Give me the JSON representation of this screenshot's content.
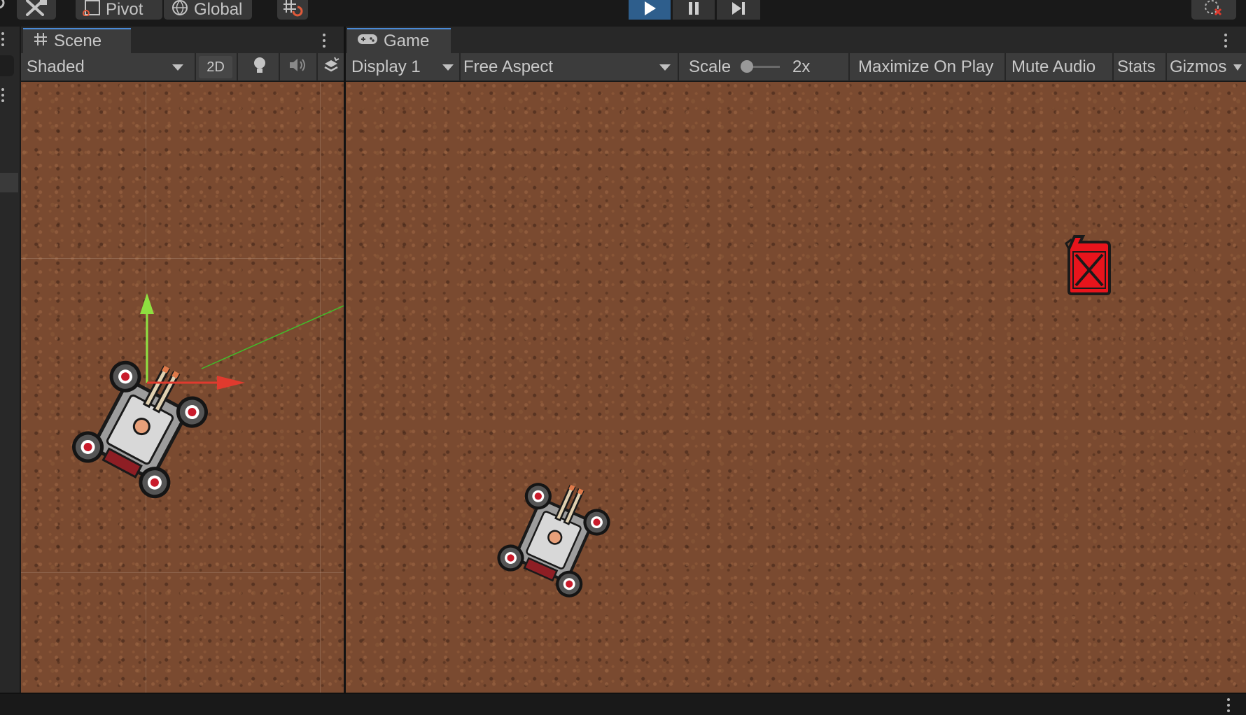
{
  "toolbar": {
    "pivot_label": "Pivot",
    "global_label": "Global",
    "play_state": "playing"
  },
  "scene_panel": {
    "tab_label": "Scene",
    "shading_mode": "Shaded",
    "mode_2d_label": "2D"
  },
  "game_panel": {
    "tab_label": "Game",
    "display_label": "Display 1",
    "aspect_label": "Free Aspect",
    "scale_label": "Scale",
    "scale_value": "2x",
    "maximize_label": "Maximize On Play",
    "mute_label": "Mute Audio",
    "stats_label": "Stats",
    "gizmos_label": "Gizmos"
  },
  "colors": {
    "play_active": "#2e5e8c",
    "tab_accent": "#4a8ad6",
    "gizmo_y": "#7ee03a",
    "gizmo_x": "#e03a2e",
    "fuel_can": "#e8141c"
  },
  "icons": {
    "tools": "hand-tools-icon",
    "pivot": "pivot-icon",
    "global": "globe-icon",
    "snap": "grid-snap-icon",
    "play": "play-icon",
    "pause": "pause-icon",
    "step": "step-icon",
    "scene_tab": "hash-icon",
    "game_tab": "gamepad-icon",
    "lighting": "lightbulb-icon",
    "audio": "speaker-icon",
    "effects": "effects-icon"
  }
}
